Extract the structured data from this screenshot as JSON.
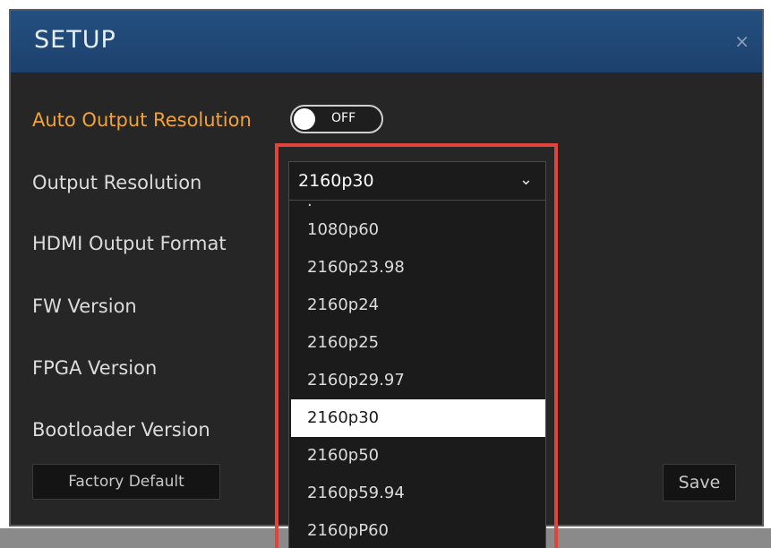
{
  "dialog": {
    "title": "SETUP",
    "close_icon": "close-icon",
    "close_glyph": "×"
  },
  "settings": {
    "auto_output_label": "Auto Output Resolution",
    "auto_output_toggle": "OFF",
    "output_resolution_label": "Output Resolution",
    "hdmi_output_format_label": "HDMI Output Format",
    "fw_version_label": "FW Version",
    "fpga_version_label": "FPGA Version",
    "bootloader_version_label": "Bootloader Version"
  },
  "select": {
    "value": "2160p30",
    "chevron_icon": "chevron-down-icon",
    "chevron_glyph": "⌄",
    "options": [
      "1080p60",
      "2160p23.98",
      "2160p24",
      "2160p25",
      "2160p29.97",
      "2160p30",
      "2160p50",
      "2160p59.94",
      "2160pP60"
    ],
    "selected": "2160p30"
  },
  "buttons": {
    "factory_default": "Factory Default",
    "save": "Save"
  },
  "colors": {
    "title_bar": "#1d416d",
    "accent": "#f2a23a",
    "highlight_border": "#e0443b",
    "background": "#262626"
  }
}
